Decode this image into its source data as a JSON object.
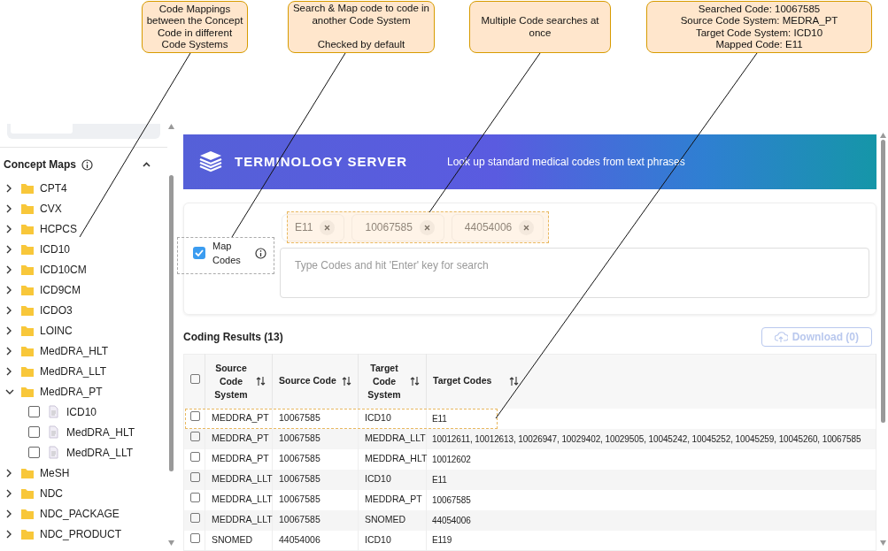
{
  "annotations": [
    {
      "lines": [
        "Code Mappings between the Concept Code in different Code Systems"
      ]
    },
    {
      "lines": [
        "Search & Map code to code in another Code System",
        "Checked by default"
      ]
    },
    {
      "lines": [
        "Multiple Code searches at once"
      ]
    },
    {
      "lines": [
        "Searched Code: 10067585",
        "Source Code System: MEDRA_PT",
        "Target Code System: ICD10",
        "Mapped Code: E11"
      ]
    }
  ],
  "sidebar": {
    "title": "Concept Maps",
    "expanded": true,
    "items": [
      {
        "label": "CPT4",
        "expanded": false
      },
      {
        "label": "CVX",
        "expanded": false
      },
      {
        "label": "HCPCS",
        "expanded": false
      },
      {
        "label": "ICD10",
        "expanded": false
      },
      {
        "label": "ICD10CM",
        "expanded": false
      },
      {
        "label": "ICD9CM",
        "expanded": false
      },
      {
        "label": "ICDO3",
        "expanded": false
      },
      {
        "label": "LOINC",
        "expanded": false
      },
      {
        "label": "MedDRA_HLT",
        "expanded": false
      },
      {
        "label": "MedDRA_LLT",
        "expanded": false
      },
      {
        "label": "MedDRA_PT",
        "expanded": true,
        "children": [
          {
            "label": "ICD10",
            "checked": false
          },
          {
            "label": "MedDRA_HLT",
            "checked": false
          },
          {
            "label": "MedDRA_LLT",
            "checked": false
          }
        ]
      },
      {
        "label": "MeSH",
        "expanded": false
      },
      {
        "label": "NDC",
        "expanded": false
      },
      {
        "label": "NDC_PACKAGE",
        "expanded": false
      },
      {
        "label": "NDC_PRODUCT",
        "expanded": false
      }
    ]
  },
  "banner": {
    "title": "TERMINOLOGY SERVER",
    "subtitle": "Look up standard medical codes from text phrases"
  },
  "search": {
    "map_codes": {
      "label": "Map Codes",
      "checked": true
    },
    "chips": [
      "E11",
      "10067585",
      "44054006"
    ],
    "placeholder": "Type Codes and hit 'Enter' key for search"
  },
  "results": {
    "title": "Coding Results (13)",
    "download": {
      "label": "Download (0)",
      "disabled": true
    },
    "all_selected": false,
    "columns": [
      "Source Code System",
      "Source Code",
      "Target Code System",
      "Target Codes"
    ],
    "rows": [
      {
        "selected": false,
        "cells": [
          "MEDDRA_PT",
          "10067585",
          "ICD10",
          "E11"
        ]
      },
      {
        "selected": false,
        "cells": [
          "MEDDRA_PT",
          "10067585",
          "MEDDRA_LLT",
          "10012611, 10012613, 10026947, 10029402, 10029505, 10045242, 10045252, 10045259, 10045260, 10067585"
        ]
      },
      {
        "selected": false,
        "cells": [
          "MEDDRA_PT",
          "10067585",
          "MEDDRA_HLT",
          "10012602"
        ]
      },
      {
        "selected": false,
        "cells": [
          "MEDDRA_LLT",
          "10067585",
          "ICD10",
          "E11"
        ]
      },
      {
        "selected": false,
        "cells": [
          "MEDDRA_LLT",
          "10067585",
          "MEDDRA_PT",
          "10067585"
        ]
      },
      {
        "selected": false,
        "cells": [
          "MEDDRA_LLT",
          "10067585",
          "SNOMED",
          "44054006"
        ]
      },
      {
        "selected": false,
        "cells": [
          "SNOMED",
          "44054006",
          "ICD10",
          "E119"
        ]
      }
    ]
  }
}
